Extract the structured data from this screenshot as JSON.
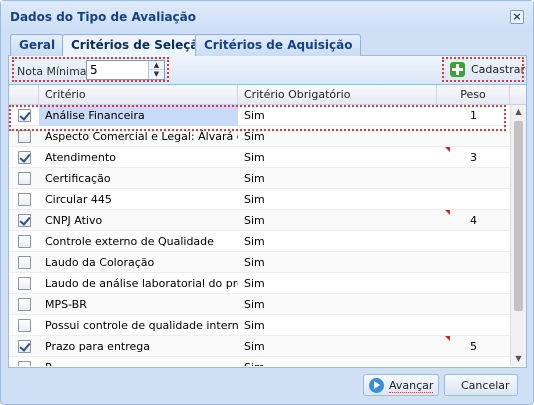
{
  "window": {
    "title": "Dados do Tipo de Avaliação"
  },
  "tabs": [
    {
      "label": "Geral",
      "active": false
    },
    {
      "label": "Critérios de Seleção",
      "active": true
    },
    {
      "label": "Critérios de Aquisição",
      "active": false
    }
  ],
  "toolbar": {
    "nota_minima_label": "Nota Mínima:",
    "nota_minima_value": "5",
    "add_label": "Cadastrar"
  },
  "grid": {
    "columns": [
      "Critério",
      "Critério Obrigatório",
      "Peso"
    ],
    "rows": [
      {
        "checked": true,
        "name": "Análise Financeira",
        "obrigatorio": "Sim",
        "peso": "1",
        "selected": true
      },
      {
        "checked": false,
        "name": "Aspecto Comercial e Legal: Álvará d...",
        "obrigatorio": "Sim",
        "peso": ""
      },
      {
        "checked": true,
        "name": "Atendimento",
        "obrigatorio": "Sim",
        "peso": "3",
        "dirty": true
      },
      {
        "checked": false,
        "name": "Certificação",
        "obrigatorio": "Sim",
        "peso": ""
      },
      {
        "checked": false,
        "name": "Circular 445",
        "obrigatorio": "Sim",
        "peso": ""
      },
      {
        "checked": true,
        "name": "CNPJ Ativo",
        "obrigatorio": "Sim",
        "peso": "4",
        "dirty": true
      },
      {
        "checked": false,
        "name": "Controle externo de Qualidade",
        "obrigatorio": "Sim",
        "peso": ""
      },
      {
        "checked": false,
        "name": "Laudo da Coloração",
        "obrigatorio": "Sim",
        "peso": ""
      },
      {
        "checked": false,
        "name": "Laudo de análise laboratorial do pro...",
        "obrigatorio": "Sim",
        "peso": ""
      },
      {
        "checked": false,
        "name": "MPS-BR",
        "obrigatorio": "Sim",
        "peso": ""
      },
      {
        "checked": false,
        "name": "Possui controle de qualidade interno",
        "obrigatorio": "Sim",
        "peso": ""
      },
      {
        "checked": true,
        "name": "Prazo para entrega",
        "obrigatorio": "Sim",
        "peso": "5",
        "dirty": true
      },
      {
        "checked": false,
        "name": "P...",
        "obrigatorio": "Sim",
        "peso": ""
      }
    ]
  },
  "footer": {
    "next_label": "Avançar",
    "cancel_label": "Cancelar"
  },
  "colors": {
    "accent": "#15428b",
    "highlight": "#e0353a",
    "selection": "#c7daf6"
  }
}
